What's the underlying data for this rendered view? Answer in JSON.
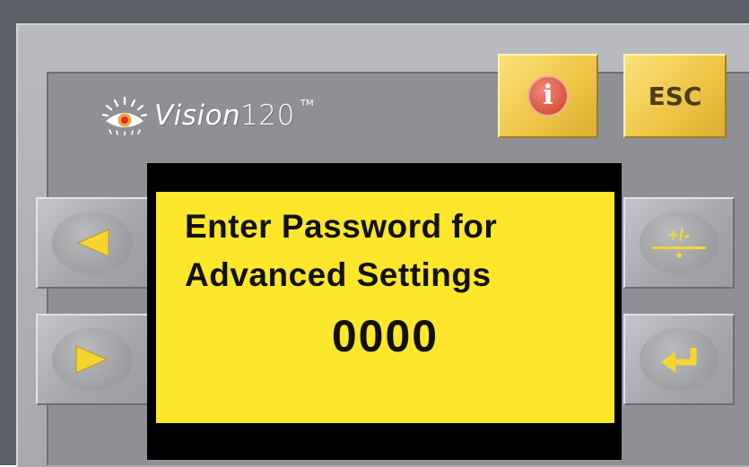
{
  "device": {
    "brand_name": "Vision",
    "brand_model": "120",
    "trademark": "TM",
    "logo_icon": "eye-icon"
  },
  "keys": {
    "info": {
      "icon": "info-icon",
      "glyph": "i"
    },
    "esc": {
      "label": "ESC"
    },
    "left": {
      "icon": "left-arrow-icon"
    },
    "right": {
      "icon": "right-arrow-icon"
    },
    "plus_minus": {
      "label": "+/-"
    },
    "enter": {
      "icon": "enter-return-icon"
    }
  },
  "lcd": {
    "line1": "Enter Password for",
    "line2": "Advanced Settings",
    "password_value": "0000"
  },
  "colors": {
    "lcd_background": "#fde72a",
    "key_yellow": "#efc648",
    "arrow_yellow": "#f5d531",
    "bezel_gray": "#aeb0b4"
  }
}
